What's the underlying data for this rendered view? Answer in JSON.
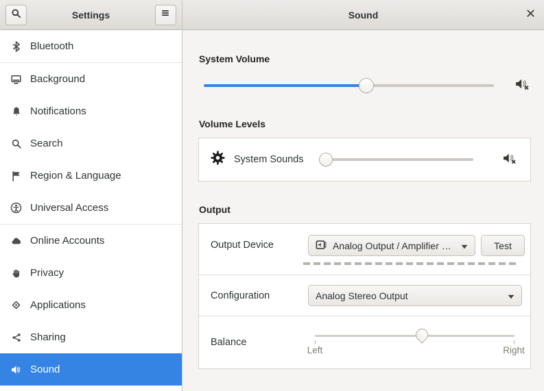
{
  "colors": {
    "accent": "#3584e4",
    "selected_text": "#ffffff",
    "headerbar_bg": "#e6e3e0",
    "content_bg": "#f5f4f2",
    "sidebar_bg": "#ffffff",
    "slider_fill": "#3584e4"
  },
  "sidebar": {
    "title": "Settings",
    "search_button_icon": "search-icon",
    "menu_button_icon": "hamburger-menu-icon",
    "items": [
      {
        "label": "Bluetooth",
        "icon": "bluetooth-icon"
      },
      {
        "label": "Background",
        "icon": "display-icon"
      },
      {
        "label": "Notifications",
        "icon": "bell-icon"
      },
      {
        "label": "Search",
        "icon": "search-icon"
      },
      {
        "label": "Region & Language",
        "icon": "flag-icon"
      },
      {
        "label": "Universal Access",
        "icon": "accessibility-icon"
      },
      {
        "label": "Online Accounts",
        "icon": "cloud-icon"
      },
      {
        "label": "Privacy",
        "icon": "hand-icon"
      },
      {
        "label": "Applications",
        "icon": "applications-icon"
      },
      {
        "label": "Sharing",
        "icon": "share-icon"
      },
      {
        "label": "Sound",
        "icon": "speaker-icon",
        "selected": true
      }
    ]
  },
  "main": {
    "title": "Sound",
    "close_icon": "close-icon",
    "system_volume": {
      "heading": "System Volume",
      "slider_percent": 56,
      "mute_icon": "speaker-muted-icon"
    },
    "volume_levels": {
      "heading": "Volume Levels",
      "rows": [
        {
          "icon": "gear-icon",
          "label": "System Sounds",
          "slider_percent": 4,
          "mute_icon": "speaker-muted-icon"
        }
      ]
    },
    "output": {
      "heading": "Output",
      "device_row": {
        "label": "Output Device",
        "dropdown_icon": "audio-card-icon",
        "dropdown_value": "Analog Output / Amplifier …",
        "dropdown_arrow": "chevron-down-icon",
        "test_button": "Test",
        "meter": "peak-level-meter"
      },
      "configuration_row": {
        "label": "Configuration",
        "dropdown_value": "Analog Stereo Output",
        "dropdown_arrow": "chevron-down-icon"
      },
      "balance_row": {
        "label": "Balance",
        "min_label": "Left",
        "max_label": "Right",
        "slider_percent": 50
      }
    }
  }
}
